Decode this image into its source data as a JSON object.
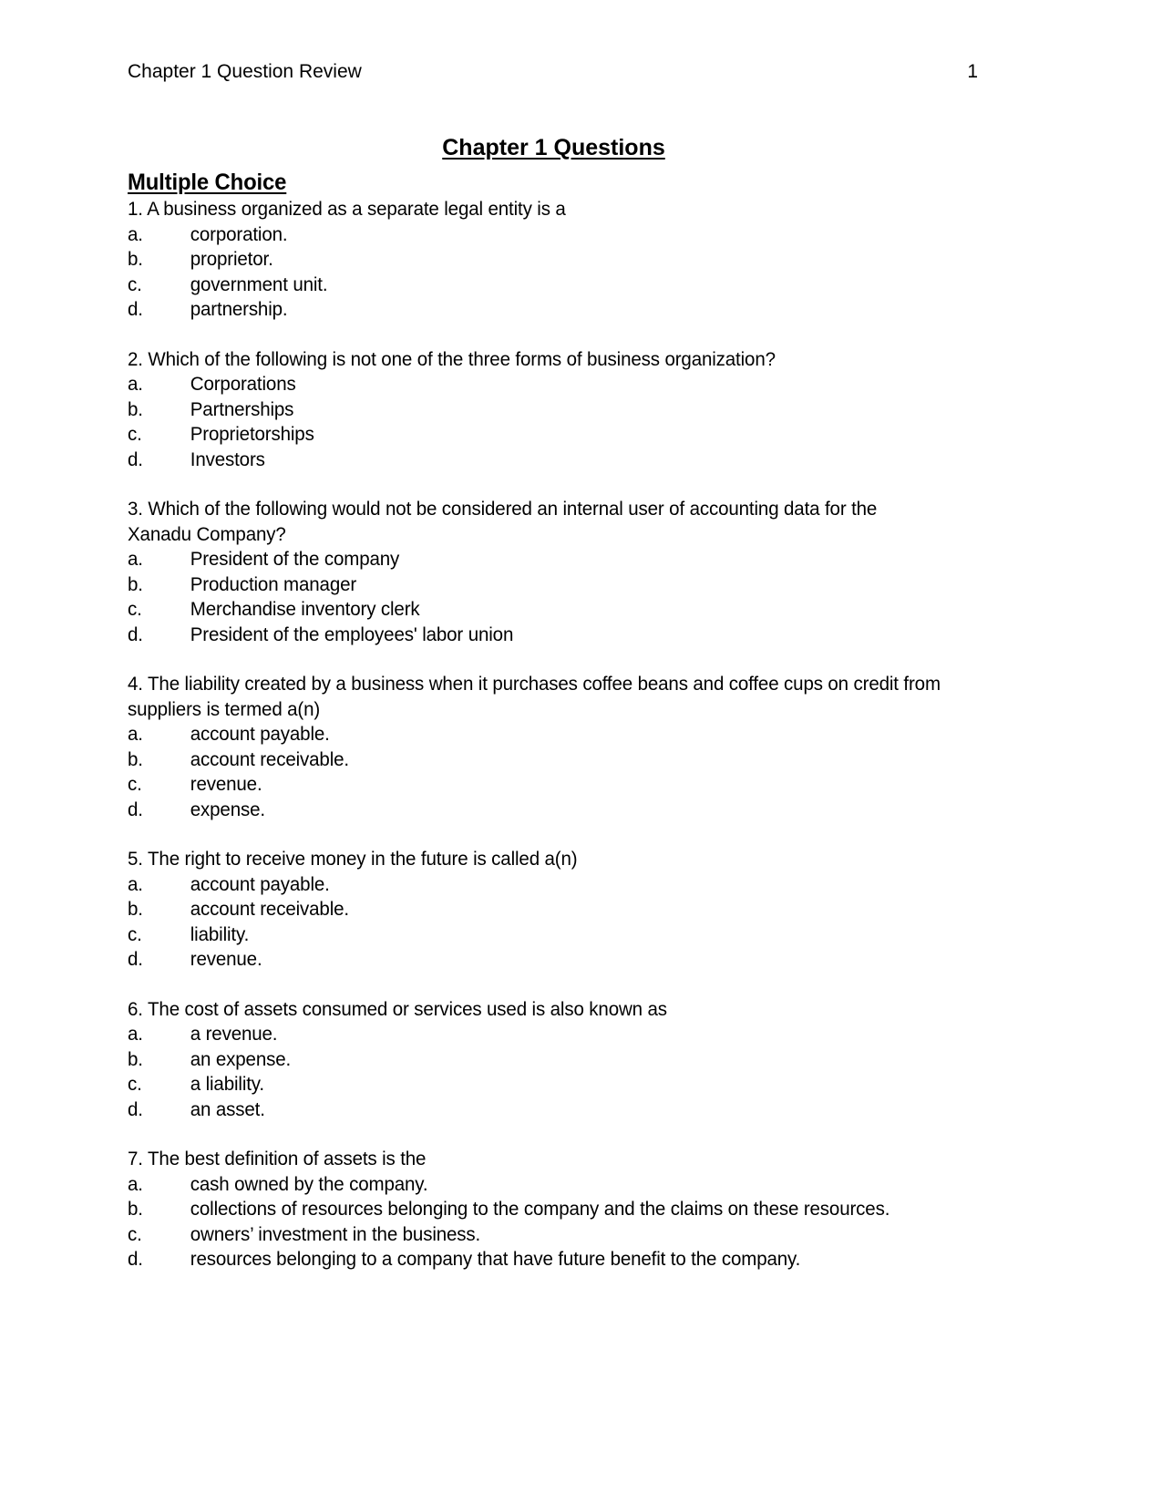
{
  "header": {
    "left": "Chapter 1 Question Review",
    "page_number": "1"
  },
  "title": "Chapter 1 Questions",
  "section": {
    "heading": "Multiple Choice"
  },
  "questions": [
    {
      "stem": "1.  A business organized as a separate legal entity is a",
      "options": [
        {
          "letter": "a.",
          "text": "corporation."
        },
        {
          "letter": "b.",
          "text": "proprietor."
        },
        {
          "letter": "c.",
          "text": "government unit."
        },
        {
          "letter": "d.",
          "text": "partnership."
        }
      ]
    },
    {
      "stem": "2.  Which of the following is not one of the three forms of business organization?",
      "options": [
        {
          "letter": "a.",
          "text": "Corporations"
        },
        {
          "letter": "b.",
          "text": "Partnerships"
        },
        {
          "letter": "c.",
          "text": "Proprietorships"
        },
        {
          "letter": "d.",
          "text": "Investors"
        }
      ]
    },
    {
      "stem": "3.  Which of the following would not be considered an internal user of accounting data for the Xanadu Company?",
      "options": [
        {
          "letter": "a.",
          "text": "President of the company"
        },
        {
          "letter": "b.",
          "text": "Production manager"
        },
        {
          "letter": "c.",
          "text": "Merchandise inventory clerk"
        },
        {
          "letter": "d.",
          "text": "President of the employees' labor union"
        }
      ]
    },
    {
      "stem": "4. The liability created by a business when it purchases coffee beans and coffee cups on credit from suppliers is termed a(n)",
      "options": [
        {
          "letter": "a.",
          "text": "account payable."
        },
        {
          "letter": "b.",
          "text": "account receivable."
        },
        {
          "letter": "c.",
          "text": "revenue."
        },
        {
          "letter": "d.",
          "text": "expense."
        }
      ]
    },
    {
      "stem": "5. The right to receive money in the future is called a(n)",
      "options": [
        {
          "letter": "a.",
          "text": "account payable."
        },
        {
          "letter": "b.",
          "text": "account receivable."
        },
        {
          "letter": "c.",
          "text": "liability."
        },
        {
          "letter": "d.",
          "text": "revenue."
        }
      ]
    },
    {
      "stem": "6.  The cost of assets consumed or services used is also known as",
      "options": [
        {
          "letter": "a.",
          "text": "a revenue."
        },
        {
          "letter": "b.",
          "text": "an expense."
        },
        {
          "letter": "c.",
          "text": "a liability."
        },
        {
          "letter": "d.",
          "text": "an asset."
        }
      ]
    },
    {
      "stem": "7. The best definition of assets is the",
      "options": [
        {
          "letter": "a.",
          "text": "cash owned by the company."
        },
        {
          "letter": "b.",
          "text": "collections of resources belonging to the company and the claims on these resources."
        },
        {
          "letter": "c.",
          "text": "owners’ investment in the business."
        },
        {
          "letter": "d.",
          "text": "resources belonging to a company that have future benefit to the company."
        }
      ]
    }
  ]
}
